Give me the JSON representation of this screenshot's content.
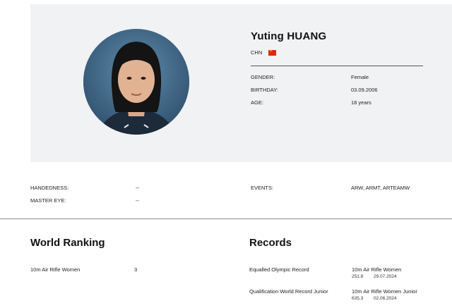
{
  "athlete": {
    "name": "Yuting HUANG",
    "country": "CHN",
    "flag_icon": "china-flag-icon",
    "gender_label": "GENDER:",
    "gender_value": "Female",
    "birthday_label": "BIRTHDAY:",
    "birthday_value": "03.09.2006",
    "age_label": "AGE:",
    "age_value": "18 years"
  },
  "details": {
    "handedness_label": "HANDEDNESS:",
    "handedness_value": "--",
    "master_eye_label": "MASTER EYE:",
    "master_eye_value": "--",
    "events_label": "EVENTS:",
    "events_value": "ARW, ARMT, ARTEAMW"
  },
  "world_ranking": {
    "title": "World Ranking",
    "rows": [
      {
        "event": "10m Air Rifle Women",
        "rank": "3"
      }
    ]
  },
  "records": {
    "title": "Records",
    "rows": [
      {
        "type": "Equalled Olympic Record",
        "event": "10m Air Rifle Women",
        "score": "251.8",
        "date": "29.07.2024"
      },
      {
        "type": "Qualification World Record Junior",
        "event": "10m Air Rifle Women Junior",
        "score": "635.3",
        "date": "02.06.2024"
      }
    ]
  },
  "colors": {
    "hero_background": "#f1f2f4",
    "flag_red": "#de2910",
    "flag_star": "#ffde00"
  }
}
